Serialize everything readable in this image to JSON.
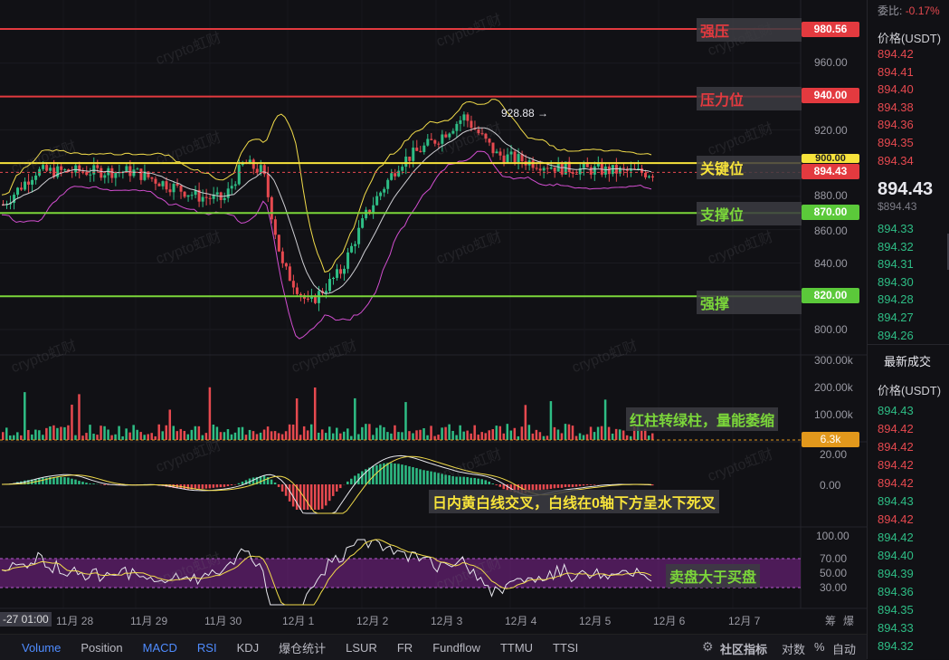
{
  "timeframe_label": "-27 01:00",
  "xaxis": [
    "11月 28",
    "11月 29",
    "11月 30",
    "12月 1",
    "12月 2",
    "12月 3",
    "12月 4",
    "12月 5",
    "12月 6",
    "12月 7"
  ],
  "yaxis_main": [
    "960.00",
    "920.00",
    "900.00",
    "880.00",
    "860.00",
    "840.00",
    "800.00"
  ],
  "yaxis_vol": [
    "300.00k",
    "200.00k",
    "100.00k"
  ],
  "yaxis_macd": [
    "20.00",
    "0.00"
  ],
  "yaxis_rsi": [
    "100.00",
    "70.00",
    "50.00",
    "30.00"
  ],
  "levels": [
    {
      "price": "980.56",
      "label": "强压",
      "color": "#e33a3f"
    },
    {
      "price": "940.00",
      "label": "压力位",
      "color": "#e33a3f"
    },
    {
      "price": "900.00",
      "label": "关键位",
      "color": "#f7e33b"
    },
    {
      "price": "870.00",
      "label": "支撑位",
      "color": "#7bd63a"
    },
    {
      "price": "820.00",
      "label": "强撑",
      "color": "#7bd63a"
    }
  ],
  "current_price_tag": "894.43",
  "high_marker": "928.88",
  "volume_tag": "6.3k",
  "annotations": {
    "volume": "红柱转绿柱，量能萎缩",
    "macd": "日内黄白线交叉，白线在0轴下方呈水下死叉",
    "rsi": "卖盘大于买盘"
  },
  "watermark": "crypto虹财",
  "toolbar": {
    "items": [
      "Volume",
      "Position",
      "MACD",
      "RSI",
      "KDJ",
      "爆仓统计",
      "LSUR",
      "FR",
      "Fundflow",
      "TTMU",
      "TTSI"
    ],
    "active": [
      "Volume",
      "MACD",
      "RSI"
    ],
    "community": "社区指标",
    "log": "对数",
    "percent": "%",
    "auto": "自动",
    "right_labels": [
      "筹",
      "爆"
    ]
  },
  "side": {
    "ratio_label": "委比:",
    "ratio_value": "-0.17%",
    "price_header": "价格(USDT)",
    "asks": [
      "894.42",
      "894.41",
      "894.40",
      "894.38",
      "894.36",
      "894.35",
      "894.34"
    ],
    "last_price": "894.43",
    "last_price_usd": "$894.43",
    "bids": [
      "894.33",
      "894.32",
      "894.31",
      "894.30",
      "894.28",
      "894.27",
      "894.26"
    ],
    "trades_title": "最新成交",
    "trades_header": "价格(USDT)",
    "trades": [
      {
        "p": "894.43",
        "c": "green"
      },
      {
        "p": "894.42",
        "c": "red"
      },
      {
        "p": "894.42",
        "c": "red"
      },
      {
        "p": "894.42",
        "c": "red"
      },
      {
        "p": "894.42",
        "c": "red"
      },
      {
        "p": "894.43",
        "c": "green"
      },
      {
        "p": "894.42",
        "c": "red"
      },
      {
        "p": "894.42",
        "c": "green"
      },
      {
        "p": "894.40",
        "c": "green"
      },
      {
        "p": "894.39",
        "c": "green"
      },
      {
        "p": "894.36",
        "c": "green"
      },
      {
        "p": "894.35",
        "c": "green"
      },
      {
        "p": "894.33",
        "c": "green"
      },
      {
        "p": "894.32",
        "c": "green"
      }
    ]
  },
  "colors": {
    "up": "#2ebd85",
    "down": "#e6494f",
    "accent": "#4f8cff"
  }
}
